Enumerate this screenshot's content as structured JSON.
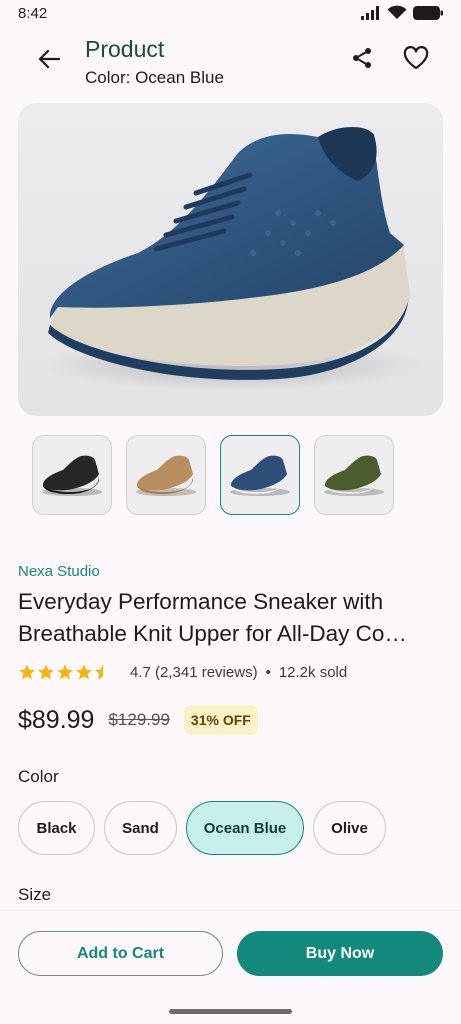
{
  "status": {
    "time": "8:42"
  },
  "header": {
    "title": "Product",
    "subtitle": "Color: Ocean Blue"
  },
  "gallery": {
    "main_image": "ocean blue knit sneaker",
    "thumbnails": [
      {
        "name": "Black",
        "color": "#262626"
      },
      {
        "name": "Sand",
        "color": "#b78f60"
      },
      {
        "name": "Ocean Blue",
        "color": "#2f4f79",
        "selected": true
      },
      {
        "name": "Olive",
        "color": "#4b5c2f"
      }
    ]
  },
  "product": {
    "brand": "Nexa Studio",
    "title": "Everyday Performance Sneaker with Breathable Knit Upper for All-Day Co…",
    "rating": 4.5,
    "rating_text": "4.7 (2,341 reviews)",
    "separator": "•",
    "sold": "12.2k sold",
    "price": "$89.99",
    "old_price": "$129.99",
    "discount": "31% OFF"
  },
  "color_section": {
    "label": "Color",
    "options": [
      "Black",
      "Sand",
      "Ocean Blue",
      "Olive"
    ],
    "selected": "Ocean Blue"
  },
  "size_section": {
    "label": "Size"
  },
  "actions": {
    "add_to_cart": "Add to Cart",
    "buy_now": "Buy Now"
  },
  "colors": {
    "accent": "#13897c",
    "star": "#f5b50a",
    "discount_bg": "#fbf1c7",
    "chip_selected_bg": "#c8efe9"
  }
}
